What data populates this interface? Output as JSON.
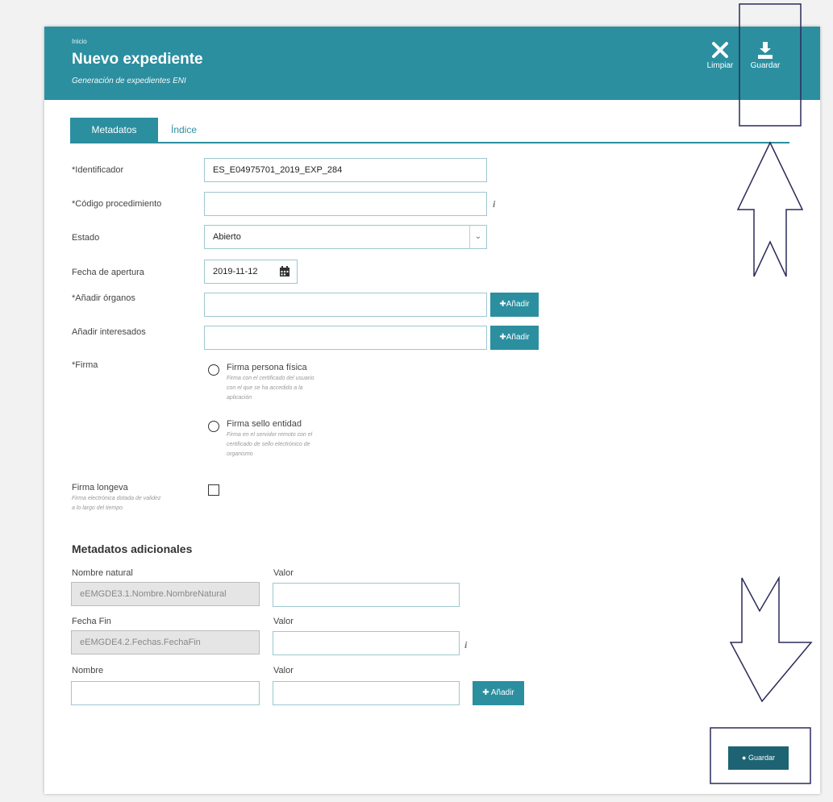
{
  "header": {
    "breadcrumb": "Inicio",
    "title": "Nuevo expediente",
    "subtitle": "Generación de expedientes ENI",
    "clear_label": "Limpiar",
    "save_label": "Guardar",
    "color": "#2b8fa0"
  },
  "tabs": [
    {
      "label": "Metadatos",
      "active": true
    },
    {
      "label": "Índice",
      "active": false
    }
  ],
  "form": {
    "identificador": {
      "label": "*Identificador",
      "value": "ES_E04975701_2019_EXP_284"
    },
    "codigo": {
      "label": "*Código procedimiento",
      "value": "",
      "info": "i"
    },
    "estado": {
      "label": "Estado",
      "value": "Abierto"
    },
    "fecha": {
      "label": "Fecha de apertura",
      "value": "2019-11-12"
    },
    "organos": {
      "label": "*Añadir órganos",
      "value": "",
      "button": "Añadir"
    },
    "interesados": {
      "label": "Añadir interesados",
      "value": "",
      "button": "Añadir"
    },
    "firma": {
      "label": "*Firma",
      "options": [
        {
          "label": "Firma persona física",
          "desc": [
            "Firma con el certificado del usuario",
            "con el que se ha accedido a la",
            "aplicación"
          ]
        },
        {
          "label": "Firma sello entidad",
          "desc": [
            "Firma en el servidor remoto con el",
            "certificado de sello electrónico de",
            "organismo"
          ]
        }
      ]
    },
    "longeva": {
      "label": "Firma longeva",
      "desc": [
        "Firma electrónica dotada de validez",
        "a lo largo del tiempo"
      ]
    }
  },
  "metadatos": {
    "heading": "Metadatos adicionales",
    "rows": [
      {
        "name_label": "Nombre natural",
        "name_value": "eEMGDE3.1.Nombre.NombreNatural",
        "value_label": "Valor",
        "value": ""
      },
      {
        "name_label": "Fecha Fin",
        "name_value": "eEMGDE4.2.Fechas.FechaFin",
        "value_label": "Valor",
        "value": "",
        "info": "i"
      },
      {
        "name_label": "Nombre",
        "name_value": "",
        "value_label": "Valor",
        "value": "",
        "button": "Añadir"
      }
    ]
  },
  "footer": {
    "save_label": "Guardar"
  }
}
